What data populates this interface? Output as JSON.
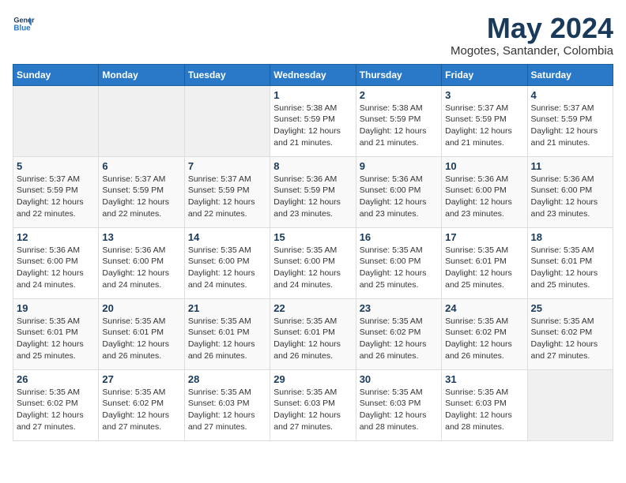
{
  "header": {
    "logo_line1": "General",
    "logo_line2": "Blue",
    "month": "May 2024",
    "location": "Mogotes, Santander, Colombia"
  },
  "days_of_week": [
    "Sunday",
    "Monday",
    "Tuesday",
    "Wednesday",
    "Thursday",
    "Friday",
    "Saturday"
  ],
  "weeks": [
    [
      {
        "day": "",
        "info": ""
      },
      {
        "day": "",
        "info": ""
      },
      {
        "day": "",
        "info": ""
      },
      {
        "day": "1",
        "info": "Sunrise: 5:38 AM\nSunset: 5:59 PM\nDaylight: 12 hours\nand 21 minutes."
      },
      {
        "day": "2",
        "info": "Sunrise: 5:38 AM\nSunset: 5:59 PM\nDaylight: 12 hours\nand 21 minutes."
      },
      {
        "day": "3",
        "info": "Sunrise: 5:37 AM\nSunset: 5:59 PM\nDaylight: 12 hours\nand 21 minutes."
      },
      {
        "day": "4",
        "info": "Sunrise: 5:37 AM\nSunset: 5:59 PM\nDaylight: 12 hours\nand 21 minutes."
      }
    ],
    [
      {
        "day": "5",
        "info": "Sunrise: 5:37 AM\nSunset: 5:59 PM\nDaylight: 12 hours\nand 22 minutes."
      },
      {
        "day": "6",
        "info": "Sunrise: 5:37 AM\nSunset: 5:59 PM\nDaylight: 12 hours\nand 22 minutes."
      },
      {
        "day": "7",
        "info": "Sunrise: 5:37 AM\nSunset: 5:59 PM\nDaylight: 12 hours\nand 22 minutes."
      },
      {
        "day": "8",
        "info": "Sunrise: 5:36 AM\nSunset: 5:59 PM\nDaylight: 12 hours\nand 23 minutes."
      },
      {
        "day": "9",
        "info": "Sunrise: 5:36 AM\nSunset: 6:00 PM\nDaylight: 12 hours\nand 23 minutes."
      },
      {
        "day": "10",
        "info": "Sunrise: 5:36 AM\nSunset: 6:00 PM\nDaylight: 12 hours\nand 23 minutes."
      },
      {
        "day": "11",
        "info": "Sunrise: 5:36 AM\nSunset: 6:00 PM\nDaylight: 12 hours\nand 23 minutes."
      }
    ],
    [
      {
        "day": "12",
        "info": "Sunrise: 5:36 AM\nSunset: 6:00 PM\nDaylight: 12 hours\nand 24 minutes."
      },
      {
        "day": "13",
        "info": "Sunrise: 5:36 AM\nSunset: 6:00 PM\nDaylight: 12 hours\nand 24 minutes."
      },
      {
        "day": "14",
        "info": "Sunrise: 5:35 AM\nSunset: 6:00 PM\nDaylight: 12 hours\nand 24 minutes."
      },
      {
        "day": "15",
        "info": "Sunrise: 5:35 AM\nSunset: 6:00 PM\nDaylight: 12 hours\nand 24 minutes."
      },
      {
        "day": "16",
        "info": "Sunrise: 5:35 AM\nSunset: 6:00 PM\nDaylight: 12 hours\nand 25 minutes."
      },
      {
        "day": "17",
        "info": "Sunrise: 5:35 AM\nSunset: 6:01 PM\nDaylight: 12 hours\nand 25 minutes."
      },
      {
        "day": "18",
        "info": "Sunrise: 5:35 AM\nSunset: 6:01 PM\nDaylight: 12 hours\nand 25 minutes."
      }
    ],
    [
      {
        "day": "19",
        "info": "Sunrise: 5:35 AM\nSunset: 6:01 PM\nDaylight: 12 hours\nand 25 minutes."
      },
      {
        "day": "20",
        "info": "Sunrise: 5:35 AM\nSunset: 6:01 PM\nDaylight: 12 hours\nand 26 minutes."
      },
      {
        "day": "21",
        "info": "Sunrise: 5:35 AM\nSunset: 6:01 PM\nDaylight: 12 hours\nand 26 minutes."
      },
      {
        "day": "22",
        "info": "Sunrise: 5:35 AM\nSunset: 6:01 PM\nDaylight: 12 hours\nand 26 minutes."
      },
      {
        "day": "23",
        "info": "Sunrise: 5:35 AM\nSunset: 6:02 PM\nDaylight: 12 hours\nand 26 minutes."
      },
      {
        "day": "24",
        "info": "Sunrise: 5:35 AM\nSunset: 6:02 PM\nDaylight: 12 hours\nand 26 minutes."
      },
      {
        "day": "25",
        "info": "Sunrise: 5:35 AM\nSunset: 6:02 PM\nDaylight: 12 hours\nand 27 minutes."
      }
    ],
    [
      {
        "day": "26",
        "info": "Sunrise: 5:35 AM\nSunset: 6:02 PM\nDaylight: 12 hours\nand 27 minutes."
      },
      {
        "day": "27",
        "info": "Sunrise: 5:35 AM\nSunset: 6:02 PM\nDaylight: 12 hours\nand 27 minutes."
      },
      {
        "day": "28",
        "info": "Sunrise: 5:35 AM\nSunset: 6:03 PM\nDaylight: 12 hours\nand 27 minutes."
      },
      {
        "day": "29",
        "info": "Sunrise: 5:35 AM\nSunset: 6:03 PM\nDaylight: 12 hours\nand 27 minutes."
      },
      {
        "day": "30",
        "info": "Sunrise: 5:35 AM\nSunset: 6:03 PM\nDaylight: 12 hours\nand 28 minutes."
      },
      {
        "day": "31",
        "info": "Sunrise: 5:35 AM\nSunset: 6:03 PM\nDaylight: 12 hours\nand 28 minutes."
      },
      {
        "day": "",
        "info": ""
      }
    ]
  ]
}
